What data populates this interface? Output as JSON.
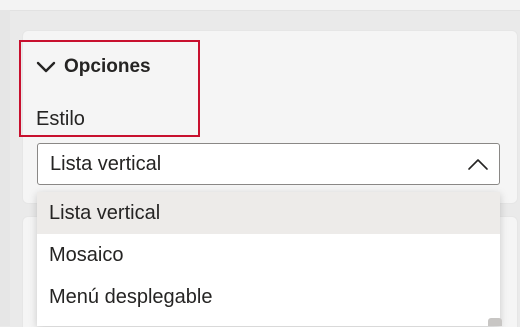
{
  "section": {
    "title": "Opciones"
  },
  "style_field": {
    "label": "Estilo",
    "selected_value": "Lista vertical",
    "options": [
      "Lista vertical",
      "Mosaico",
      "Menú desplegable"
    ]
  },
  "colors": {
    "highlight_border": "#c8102e",
    "selected_option_bg": "#edebe9",
    "text": "#252423"
  },
  "icons": {
    "section_toggle": "chevron-down-icon",
    "select_toggle": "chevron-up-icon"
  }
}
